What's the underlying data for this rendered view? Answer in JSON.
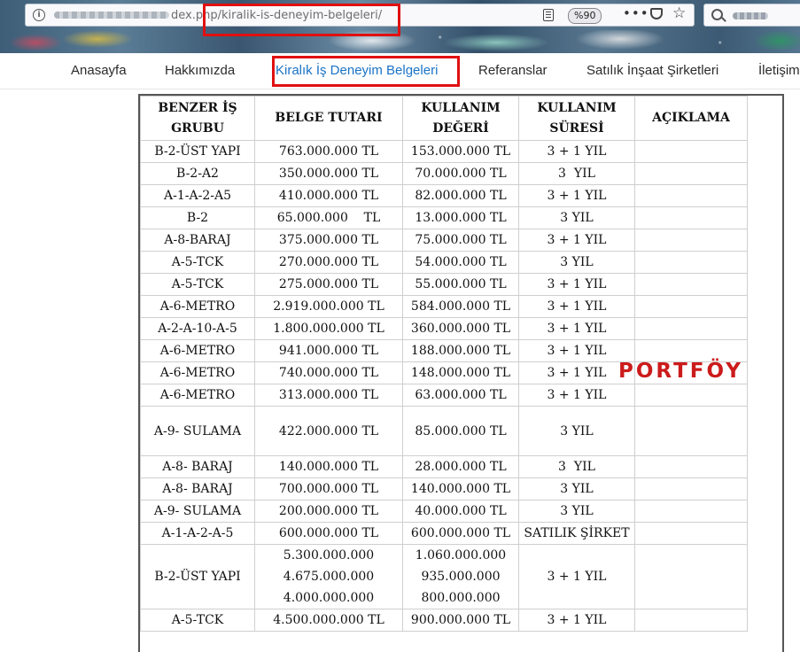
{
  "browser": {
    "url_visible": "dex.php/kiralik-is-deneyim-belgeleri/",
    "zoom": "%90"
  },
  "nav": {
    "items": [
      {
        "label": "Anasayfa"
      },
      {
        "label": "Hakkımızda"
      },
      {
        "label": "Kiralık İş Deneyim Belgeleri"
      },
      {
        "label": "Referanslar"
      },
      {
        "label": "Satılık İnşaat Şirketleri"
      },
      {
        "label": "İletişim"
      }
    ],
    "active_index": 2
  },
  "table": {
    "headers": {
      "c1_line1": "BENZER İŞ",
      "c1_line2": "GRUBU",
      "c2": "BELGE TUTARI",
      "c3_line1": "KULLANIM",
      "c3_line2": "DEĞERİ",
      "c4_line1": "KULLANIM",
      "c4_line2": "SÜRESİ",
      "c5": "AÇIKLAMA"
    },
    "rows": [
      {
        "grup": "B-2-ÜST YAPI",
        "tutar": "763.000.000 TL",
        "deger": "153.000.000 TL",
        "sure": "3 + 1 YIL",
        "aciklama": ""
      },
      {
        "grup": "B-2-A2",
        "tutar": "350.000.000 TL",
        "deger": "70.000.000 TL",
        "sure": "3  YIL",
        "aciklama": ""
      },
      {
        "grup": "A-1-A-2-A5",
        "tutar": "410.000.000 TL",
        "deger": "82.000.000 TL",
        "sure": "3 + 1 YIL",
        "aciklama": ""
      },
      {
        "grup": "B-2",
        "tutar": "65.000.000    TL",
        "deger": "13.000.000 TL",
        "sure": "3 YIL",
        "aciklama": ""
      },
      {
        "grup": "A-8-BARAJ",
        "tutar": "375.000.000 TL",
        "deger": "75.000.000 TL",
        "sure": "3 + 1 YIL",
        "aciklama": ""
      },
      {
        "grup": "A-5-TCK",
        "tutar": "270.000.000 TL",
        "deger": "54.000.000 TL",
        "sure": "3 YIL",
        "aciklama": ""
      },
      {
        "grup": "A-5-TCK",
        "tutar": "275.000.000 TL",
        "deger": "55.000.000 TL",
        "sure": "3 + 1 YIL",
        "aciklama": ""
      },
      {
        "grup": "A-6-METRO",
        "tutar": "2.919.000.000 TL",
        "deger": "584.000.000 TL",
        "sure": "3 + 1 YIL",
        "aciklama": ""
      },
      {
        "grup": "A-2-A-10-A-5",
        "tutar": "1.800.000.000 TL",
        "deger": "360.000.000 TL",
        "sure": "3 + 1 YIL",
        "aciklama": ""
      },
      {
        "grup": "A-6-METRO",
        "tutar": "941.000.000 TL",
        "deger": "188.000.000 TL",
        "sure": "3 + 1 YIL",
        "aciklama": ""
      },
      {
        "grup": "A-6-METRO",
        "tutar": "740.000.000 TL",
        "deger": "148.000.000 TL",
        "sure": "3 + 1 YIL",
        "aciklama": ""
      },
      {
        "grup": "A-6-METRO",
        "tutar": "313.000.000 TL",
        "deger": "63.000.000 TL",
        "sure": "3 + 1 YIL",
        "aciklama": ""
      },
      {
        "grup": "A-9- SULAMA",
        "tutar": "422.000.000 TL",
        "deger": "85.000.000 TL",
        "sure": "3 YIL",
        "aciklama": ""
      },
      {
        "grup": "A-8- BARAJ",
        "tutar": "140.000.000 TL",
        "deger": "28.000.000 TL",
        "sure": "3  YIL",
        "aciklama": ""
      },
      {
        "grup": "A-8- BARAJ",
        "tutar": "700.000.000 TL",
        "deger": "140.000.000 TL",
        "sure": "3 YIL",
        "aciklama": ""
      },
      {
        "grup": "A-9- SULAMA",
        "tutar": "200.000.000 TL",
        "deger": "40.000.000 TL",
        "sure": "3 YIL",
        "aciklama": ""
      },
      {
        "grup": "A-1-A-2-A-5",
        "tutar": "600.000.000 TL",
        "deger": "600.000.000 TL",
        "sure": "SATILIK ŞİRKET",
        "aciklama": ""
      },
      {
        "grup": "B-2-ÜST YAPI",
        "tutar_lines": [
          "5.300.000.000",
          "4.675.000.000",
          "4.000.000.000"
        ],
        "deger_lines": [
          "1.060.000.000",
          "935.000.000",
          "800.000.000"
        ],
        "sure": "3 + 1 YIL",
        "aciklama": ""
      },
      {
        "grup": "A-5-TCK",
        "tutar": "4.500.000.000 TL",
        "deger": "900.000.000 TL",
        "sure": "3 + 1 YIL",
        "aciklama": ""
      }
    ]
  },
  "watermark": "PORTFÖY",
  "colors": {
    "active_nav": "#1a73c6",
    "highlight_box": "#e01010",
    "watermark": "#cc1b1b"
  }
}
